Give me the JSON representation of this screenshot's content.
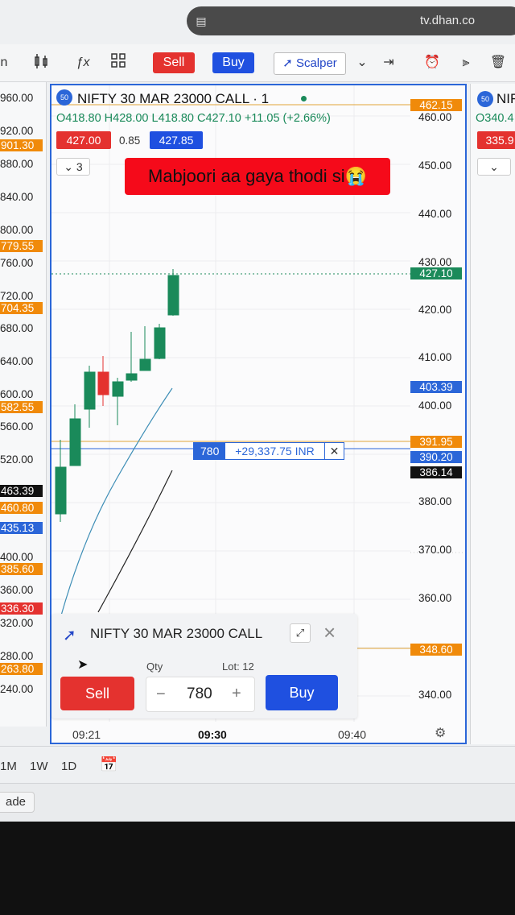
{
  "browser": {
    "url": "tv.dhan.co"
  },
  "toolbar": {
    "sell": "Sell",
    "buy": "Buy",
    "scalper": "Scalper"
  },
  "chart": {
    "symbol_title": "NIFTY 30 MAR 23000 CALL · 1",
    "ohlc": {
      "o": "O418.80",
      "h": "H428.00",
      "l": "L418.80",
      "c": "C427.10",
      "chg": "+11.05 (+2.66%)"
    },
    "bid": "427.00",
    "spread": "0.85",
    "ask": "427.85",
    "collapse": "3",
    "banner": "Mabjoori aa gaya thodi si😭",
    "right_axis": [
      "460.00",
      "450.00",
      "440.00",
      "430.00",
      "420.00",
      "410.00",
      "400.00",
      "380.00",
      "370.00",
      "360.00",
      "340.00"
    ],
    "right_badges": {
      "top": "462.15",
      "last": "427.10",
      "ma": "403.39",
      "pos": "391.95",
      "mid": "390.20",
      "dark": "386.14",
      "low": "348.60"
    },
    "position": {
      "qty": "780",
      "pnl": "+29,337.75 INR",
      "close": "✕"
    },
    "time_axis": [
      "09:21",
      "09:30",
      "09:40"
    ]
  },
  "left_axis": {
    "values": [
      "960.00",
      "920.00",
      "880.00",
      "840.00",
      "800.00",
      "760.00",
      "720.00",
      "680.00",
      "640.00",
      "600.00",
      "560.00",
      "520.00",
      "400.00",
      "360.00",
      "320.00",
      "280.00",
      "240.00"
    ],
    "badges": {
      "b901": "901.30",
      "b779": "779.55",
      "b704": "704.35",
      "b582": "582.55",
      "b463": "463.39",
      "b460": "460.80",
      "b435": "435.13",
      "b385": "385.60",
      "b336": "336.30",
      "b263": "263.80"
    }
  },
  "right_pane": {
    "title": "NIF",
    "o": "O340.4",
    "bid": "335.9",
    "collapse": ""
  },
  "order_panel": {
    "title": "NIFTY 30 MAR 23000 CALL",
    "qty_label": "Qty",
    "lot_label": "Lot: 12",
    "qty": "780",
    "sell": "Sell",
    "buy": "Buy",
    "minus": "−",
    "plus": "+"
  },
  "bottom": {
    "ranges": [
      "1M",
      "1W",
      "1D"
    ]
  },
  "footer": {
    "trade": "ade"
  }
}
